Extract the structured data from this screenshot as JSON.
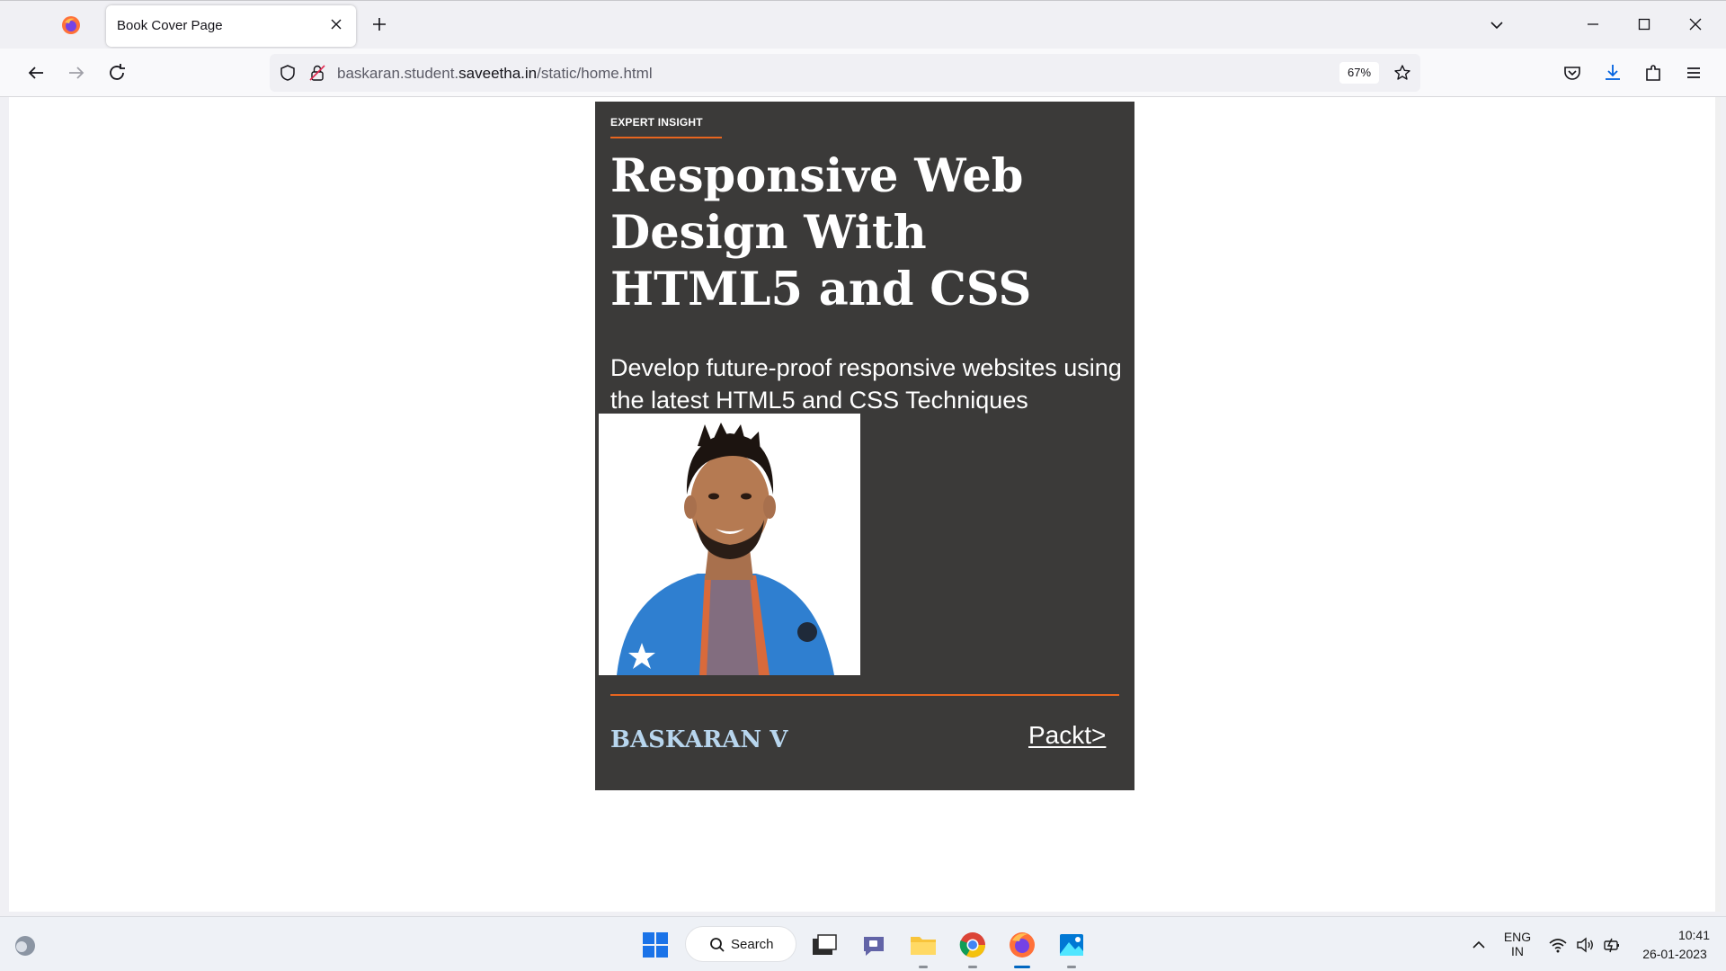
{
  "browser": {
    "tab": {
      "title": "Book Cover Page"
    },
    "url": {
      "prefix": "baskaran.student.",
      "domain": "saveetha.in",
      "path": "/static/home.html"
    },
    "zoom": "67%"
  },
  "cover": {
    "badge": "EXPERT INSIGHT",
    "title": "Responsive Web Design With HTML5 and CSS",
    "subtitle": "Develop future-proof responsive websites using the latest HTML5 and CSS Techniques",
    "author": "BASKARAN V",
    "publisher": "Packt>",
    "colors": {
      "background": "#3b3a39",
      "accent": "#e8651f",
      "author": "#b8d6ee"
    }
  },
  "taskbar": {
    "search_label": "Search",
    "language": {
      "line1": "ENG",
      "line2": "IN"
    },
    "clock": {
      "time": "10:41",
      "date": "26-01-2023"
    }
  }
}
